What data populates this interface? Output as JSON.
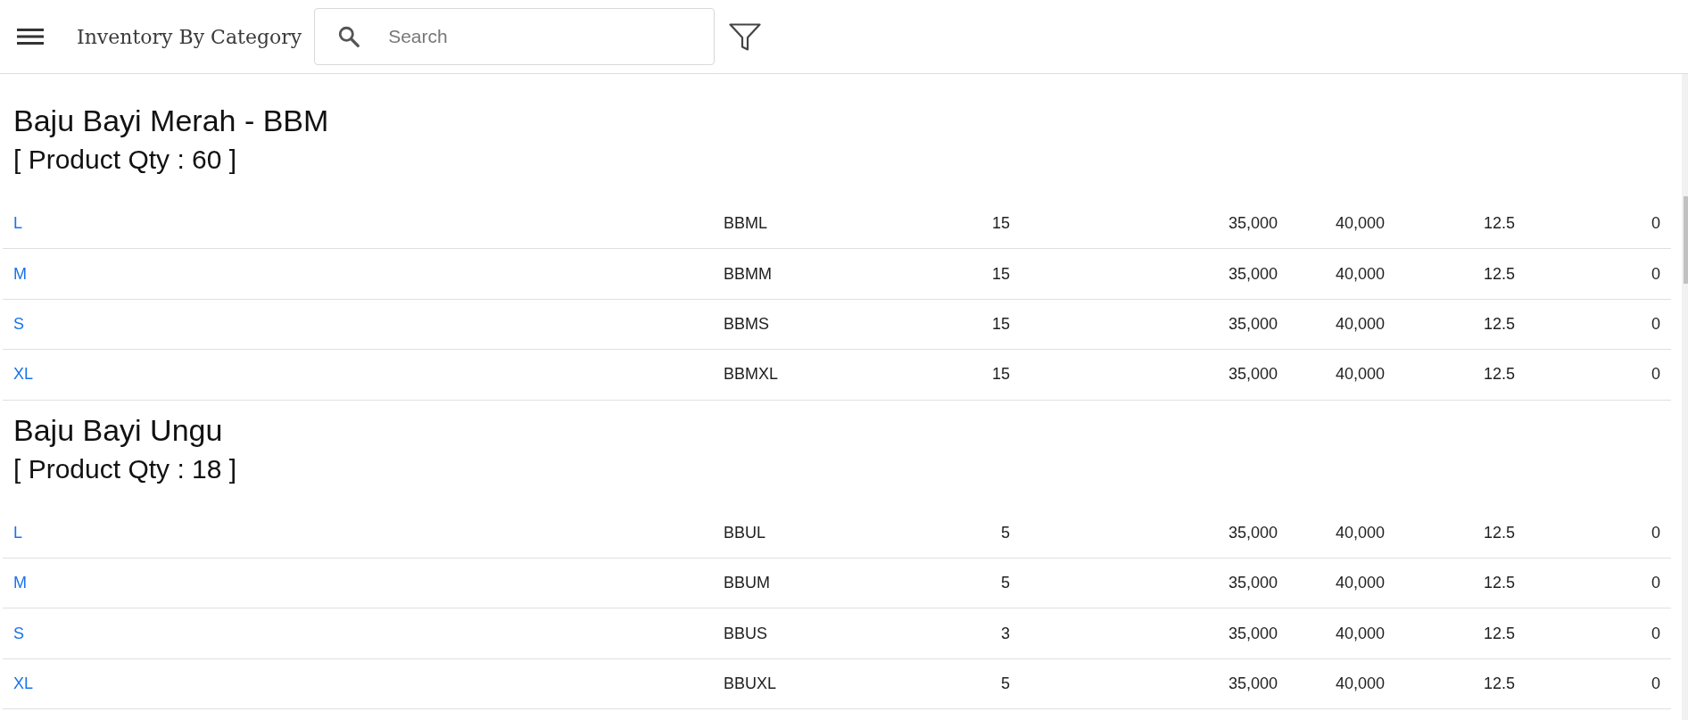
{
  "toolbar": {
    "title": "Inventory By Category",
    "search": {
      "placeholder": "Search"
    }
  },
  "groups": [
    {
      "title": "Baju Bayi Merah - BBM",
      "qty": "[ Product Qty : 60 ]",
      "rows": [
        {
          "cells": [
            "L",
            "BBML",
            "15",
            "35,000",
            "40,000",
            "12.5",
            "0"
          ]
        },
        {
          "cells": [
            "M",
            "BBMM",
            "15",
            "35,000",
            "40,000",
            "12.5",
            "0"
          ]
        },
        {
          "cells": [
            "S",
            "BBMS",
            "15",
            "35,000",
            "40,000",
            "12.5",
            "0"
          ]
        },
        {
          "cells": [
            "XL",
            "BBMXL",
            "15",
            "35,000",
            "40,000",
            "12.5",
            "0"
          ]
        }
      ]
    },
    {
      "title": "Baju Bayi Ungu",
      "qty": "[ Product Qty : 18 ]",
      "rows": [
        {
          "cells": [
            "L",
            "BBUL",
            "5",
            "35,000",
            "40,000",
            "12.5",
            "0"
          ]
        },
        {
          "cells": [
            "M",
            "BBUM",
            "5",
            "35,000",
            "40,000",
            "12.5",
            "0"
          ]
        },
        {
          "cells": [
            "S",
            "BBUS",
            "3",
            "35,000",
            "40,000",
            "12.5",
            "0"
          ]
        },
        {
          "cells": [
            "XL",
            "BBUXL",
            "5",
            "35,000",
            "40,000",
            "12.5",
            "0"
          ]
        }
      ]
    }
  ]
}
